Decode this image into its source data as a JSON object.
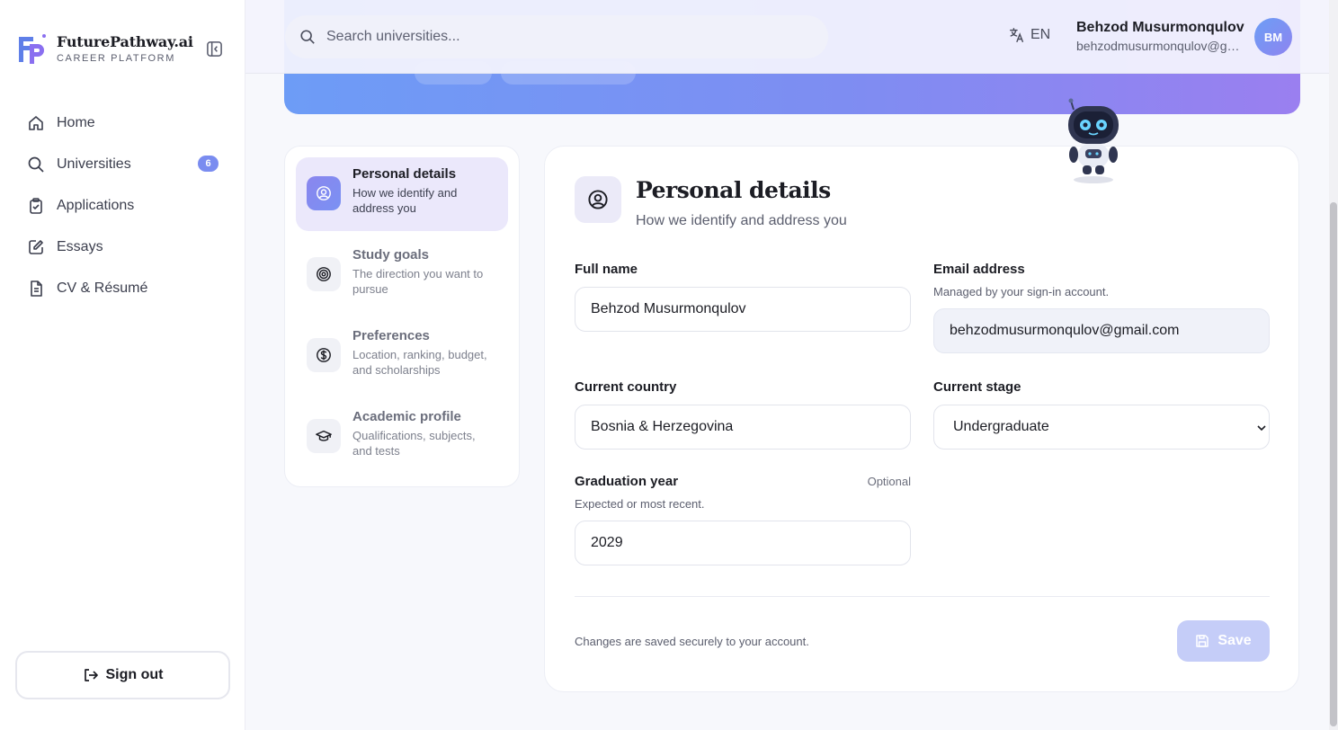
{
  "brand": {
    "name": "FuturePathway.ai",
    "subtitle": "CAREER PLATFORM",
    "logo_letters": "FP"
  },
  "sidebar": {
    "items": [
      {
        "label": "Home",
        "icon": "home-icon"
      },
      {
        "label": "Universities",
        "icon": "search-icon",
        "badge": "6"
      },
      {
        "label": "Applications",
        "icon": "clipboard-icon"
      },
      {
        "label": "Essays",
        "icon": "pen-icon"
      },
      {
        "label": "CV & Résumé",
        "icon": "document-icon"
      }
    ],
    "sign_out": "Sign out"
  },
  "topbar": {
    "search_placeholder": "Search universities...",
    "language": "EN",
    "user_name": "Behzod Musurmonqulov",
    "user_email": "behzodmusurmonqulov@gmail.com",
    "avatar_initials": "BM"
  },
  "steps": [
    {
      "title": "Personal details",
      "desc": "How we identify and address you",
      "icon": "user-circle-icon",
      "active": true
    },
    {
      "title": "Study goals",
      "desc": "The direction you want to pursue",
      "icon": "target-icon"
    },
    {
      "title": "Preferences",
      "desc": "Location, ranking, budget, and scholarships",
      "icon": "dollar-circle-icon"
    },
    {
      "title": "Academic profile",
      "desc": "Qualifications, subjects, and tests",
      "icon": "graduation-cap-icon"
    }
  ],
  "form": {
    "title": "Personal details",
    "subtitle": "How we identify and address you",
    "full_name": {
      "label": "Full name",
      "value": "Behzod Musurmonqulov"
    },
    "email": {
      "label": "Email address",
      "help": "Managed by your sign-in account.",
      "value": "behzodmusurmonqulov@gmail.com"
    },
    "country": {
      "label": "Current country",
      "value": "Bosnia & Herzegovina"
    },
    "stage": {
      "label": "Current stage",
      "value": "Undergraduate"
    },
    "graduation": {
      "label": "Graduation year",
      "optional": "Optional",
      "help": "Expected or most recent.",
      "value": "2029"
    },
    "footnote": "Changes are saved securely to your account.",
    "save_label": "Save"
  },
  "colors": {
    "accent": "#7a8cf0",
    "active_step_bg": "#ebe8fb",
    "save_disabled": "#c5cdf8"
  }
}
